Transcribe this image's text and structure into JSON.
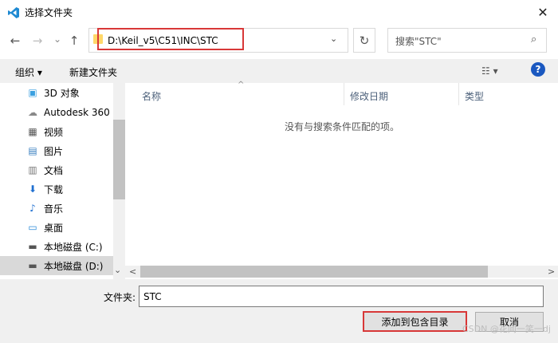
{
  "window": {
    "title": "选择文件夹",
    "close_glyph": "✕"
  },
  "nav": {
    "back": "←",
    "forward": "→",
    "history": "⌄",
    "up": "↑"
  },
  "address": {
    "path": "D:\\Keil_v5\\C51\\INC\\STC",
    "dropdown": "⌄",
    "refresh": "↻"
  },
  "search": {
    "placeholder": "搜索\"STC\"",
    "icon": "⌕"
  },
  "toolbar": {
    "organize": "组织 ▾",
    "new_folder": "新建文件夹",
    "view_glyph": "☷ ▾",
    "help": "?"
  },
  "sidebar": {
    "items": [
      {
        "label": "3D 对象",
        "icon": "3d-objects-icon",
        "glyph": "▣",
        "color": "#3aa0e0"
      },
      {
        "label": "Autodesk 360",
        "icon": "cloud-icon",
        "glyph": "☁",
        "color": "#888888"
      },
      {
        "label": "视频",
        "icon": "video-icon",
        "glyph": "▦",
        "color": "#555555"
      },
      {
        "label": "图片",
        "icon": "pictures-icon",
        "glyph": "▤",
        "color": "#3a7fc0"
      },
      {
        "label": "文档",
        "icon": "documents-icon",
        "glyph": "▥",
        "color": "#777777"
      },
      {
        "label": "下载",
        "icon": "download-icon",
        "glyph": "⬇",
        "color": "#1f6fd0"
      },
      {
        "label": "音乐",
        "icon": "music-icon",
        "glyph": "♪",
        "color": "#1f6fd0"
      },
      {
        "label": "桌面",
        "icon": "desktop-icon",
        "glyph": "▭",
        "color": "#2b8ad8"
      },
      {
        "label": "本地磁盘 (C:)",
        "icon": "drive-c-icon",
        "glyph": "▬",
        "color": "#555555"
      },
      {
        "label": "本地磁盘 (D:)",
        "icon": "drive-d-icon",
        "glyph": "▬",
        "color": "#555555",
        "selected": true
      }
    ],
    "scroll_down": "⌄"
  },
  "columns": {
    "name": "名称",
    "modified": "修改日期",
    "type": "类型",
    "sort_glyph": "^"
  },
  "empty_message": "没有与搜索条件匹配的项。",
  "hscroll": {
    "left": "<",
    "right": ">"
  },
  "footer": {
    "folder_label": "文件夹:",
    "folder_value": "STC",
    "ok_label": "添加到包含目录",
    "cancel_label": "取消"
  },
  "watermark": "CSDN @花间一笑一dj"
}
